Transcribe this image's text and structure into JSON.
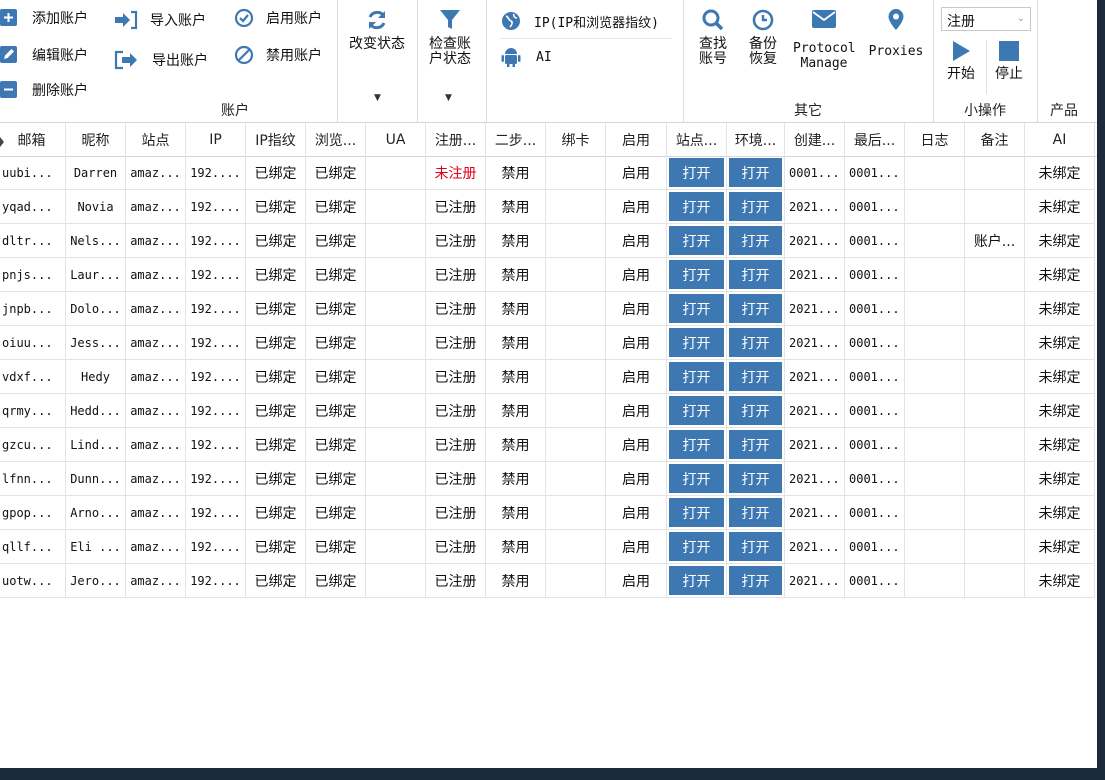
{
  "colors": {
    "accent": "#3e78b3",
    "danger": "#e0001a",
    "frame": "#1b2b3d"
  },
  "ribbon": {
    "account_group": {
      "label": "账户",
      "add": "添加账户",
      "edit": "编辑账户",
      "delete": "删除账户",
      "import": "导入账户",
      "export": "导出账户",
      "enable": "启用账户",
      "disable": "禁用账户",
      "change_status": "改变状态",
      "check_status_1": "检查账",
      "check_status_2": "户状态"
    },
    "ip_group": {
      "ip_fingerprint": "IP(IP和浏览器指纹)",
      "ai": "AI"
    },
    "other_group": {
      "label": "其它",
      "find_1": "查找",
      "find_2": "账号",
      "backup_1": "备份",
      "backup_2": "恢复",
      "protocol_1": "Protocol",
      "protocol_2": "Manage",
      "proxies": "Proxies"
    },
    "small_ops": {
      "label": "小操作",
      "select_value": "注册",
      "start": "开始",
      "stop": "停止"
    },
    "product": {
      "label": "产品"
    }
  },
  "table": {
    "headers": [
      "邮箱",
      "昵称",
      "站点",
      "IP",
      "IP指纹",
      "浏览...",
      "UA",
      "注册...",
      "二步...",
      "绑卡",
      "启用",
      "站点...",
      "环境...",
      "创建...",
      "最后...",
      "日志",
      "备注",
      "AI"
    ],
    "rows": [
      [
        "uubi...",
        "Darren",
        "amaz...",
        "192....",
        "已绑定",
        "已绑定",
        "",
        "未注册",
        "禁用",
        "",
        "启用",
        "打开",
        "打开",
        "0001...",
        "0001...",
        "",
        "",
        "未绑定"
      ],
      [
        "yqad...",
        "Novia",
        "amaz...",
        "192....",
        "已绑定",
        "已绑定",
        "",
        "已注册",
        "禁用",
        "",
        "启用",
        "打开",
        "打开",
        "2021...",
        "0001...",
        "",
        "",
        "未绑定"
      ],
      [
        "dltr...",
        "Nels...",
        "amaz...",
        "192....",
        "已绑定",
        "已绑定",
        "",
        "已注册",
        "禁用",
        "",
        "启用",
        "打开",
        "打开",
        "2021...",
        "0001...",
        "",
        "账户...",
        "未绑定"
      ],
      [
        "pnjs...",
        "Laur...",
        "amaz...",
        "192....",
        "已绑定",
        "已绑定",
        "",
        "已注册",
        "禁用",
        "",
        "启用",
        "打开",
        "打开",
        "2021...",
        "0001...",
        "",
        "",
        "未绑定"
      ],
      [
        "jnpb...",
        "Dolo...",
        "amaz...",
        "192....",
        "已绑定",
        "已绑定",
        "",
        "已注册",
        "禁用",
        "",
        "启用",
        "打开",
        "打开",
        "2021...",
        "0001...",
        "",
        "",
        "未绑定"
      ],
      [
        "oiuu...",
        "Jess...",
        "amaz...",
        "192....",
        "已绑定",
        "已绑定",
        "",
        "已注册",
        "禁用",
        "",
        "启用",
        "打开",
        "打开",
        "2021...",
        "0001...",
        "",
        "",
        "未绑定"
      ],
      [
        "vdxf...",
        "Hedy",
        "amaz...",
        "192....",
        "已绑定",
        "已绑定",
        "",
        "已注册",
        "禁用",
        "",
        "启用",
        "打开",
        "打开",
        "2021...",
        "0001...",
        "",
        "",
        "未绑定"
      ],
      [
        "qrmy...",
        "Hedd...",
        "amaz...",
        "192....",
        "已绑定",
        "已绑定",
        "",
        "已注册",
        "禁用",
        "",
        "启用",
        "打开",
        "打开",
        "2021...",
        "0001...",
        "",
        "",
        "未绑定"
      ],
      [
        "gzcu...",
        "Lind...",
        "amaz...",
        "192....",
        "已绑定",
        "已绑定",
        "",
        "已注册",
        "禁用",
        "",
        "启用",
        "打开",
        "打开",
        "2021...",
        "0001...",
        "",
        "",
        "未绑定"
      ],
      [
        "lfnn...",
        "Dunn...",
        "amaz...",
        "192....",
        "已绑定",
        "已绑定",
        "",
        "已注册",
        "禁用",
        "",
        "启用",
        "打开",
        "打开",
        "2021...",
        "0001...",
        "",
        "",
        "未绑定"
      ],
      [
        "gpop...",
        "Arno...",
        "amaz...",
        "192....",
        "已绑定",
        "已绑定",
        "",
        "已注册",
        "禁用",
        "",
        "启用",
        "打开",
        "打开",
        "2021...",
        "0001...",
        "",
        "",
        "未绑定"
      ],
      [
        "qllf...",
        "Eli ...",
        "amaz...",
        "192....",
        "已绑定",
        "已绑定",
        "",
        "已注册",
        "禁用",
        "",
        "启用",
        "打开",
        "打开",
        "2021...",
        "0001...",
        "",
        "",
        "未绑定"
      ],
      [
        "uotw...",
        "Jero...",
        "amaz...",
        "192....",
        "已绑定",
        "已绑定",
        "",
        "已注册",
        "禁用",
        "",
        "启用",
        "打开",
        "打开",
        "2021...",
        "0001...",
        "",
        "",
        "未绑定"
      ]
    ]
  }
}
